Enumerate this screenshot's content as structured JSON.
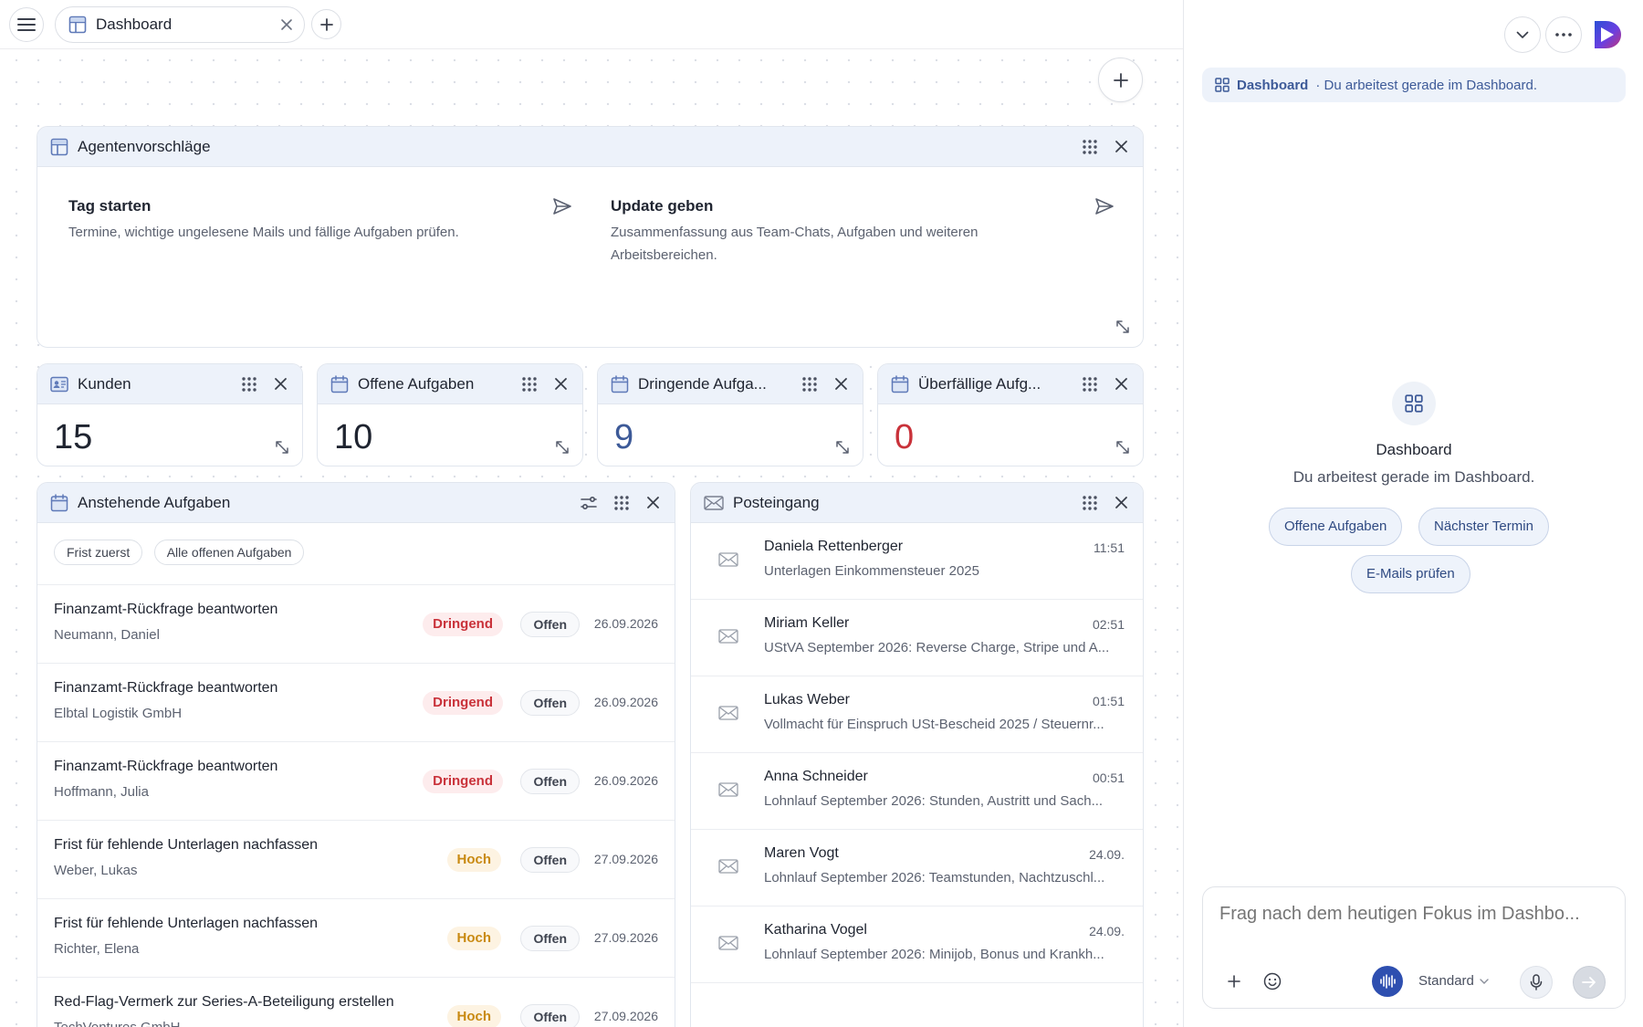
{
  "tab": {
    "label": "Dashboard"
  },
  "suggestions": {
    "title": "Agentenvorschläge",
    "items": [
      {
        "title": "Tag starten",
        "desc": "Termine, wichtige ungelesene Mails und fällige Aufgaben prüfen."
      },
      {
        "title": "Update geben",
        "desc": "Zusammenfassung aus Team-Chats, Aufgaben und weiteren Arbeitsbereichen."
      }
    ]
  },
  "stats": [
    {
      "title": "Kunden",
      "value": "15",
      "color": "#1f2430"
    },
    {
      "title": "Offene Aufgaben",
      "value": "10",
      "color": "#1f2430"
    },
    {
      "title": "Dringende Aufga...",
      "value": "9",
      "color": "#3d5a98"
    },
    {
      "title": "Überfällige Aufg...",
      "value": "0",
      "color": "#c9323a"
    }
  ],
  "tasks": {
    "title": "Anstehende Aufgaben",
    "filters": [
      "Frist zuerst",
      "Alle offenen Aufgaben"
    ],
    "rows": [
      {
        "title": "Finanzamt-Rückfrage beantworten",
        "client": "Neumann, Daniel",
        "priority": "Dringend",
        "status": "Offen",
        "date": "26.09.2026"
      },
      {
        "title": "Finanzamt-Rückfrage beantworten",
        "client": "Elbtal Logistik GmbH",
        "priority": "Dringend",
        "status": "Offen",
        "date": "26.09.2026"
      },
      {
        "title": "Finanzamt-Rückfrage beantworten",
        "client": "Hoffmann, Julia",
        "priority": "Dringend",
        "status": "Offen",
        "date": "26.09.2026"
      },
      {
        "title": "Frist für fehlende Unterlagen nachfassen",
        "client": "Weber, Lukas",
        "priority": "Hoch",
        "status": "Offen",
        "date": "27.09.2026"
      },
      {
        "title": "Frist für fehlende Unterlagen nachfassen",
        "client": "Richter, Elena",
        "priority": "Hoch",
        "status": "Offen",
        "date": "27.09.2026"
      },
      {
        "title": "Red-Flag-Vermerk zur Series-A-Beteiligung erstellen",
        "client": "TechVentures GmbH",
        "priority": "Hoch",
        "status": "Offen",
        "date": "27.09.2026"
      }
    ]
  },
  "inbox": {
    "title": "Posteingang",
    "mails": [
      {
        "from": "Daniela Rettenberger",
        "time": "11:51",
        "subject": "Unterlagen Einkommensteuer 2025"
      },
      {
        "from": "Miriam Keller",
        "time": "02:51",
        "subject": "UStVA September 2026: Reverse Charge, Stripe und A..."
      },
      {
        "from": "Lukas Weber",
        "time": "01:51",
        "subject": "Vollmacht für Einspruch USt-Bescheid 2025 / Steuernr..."
      },
      {
        "from": "Anna Schneider",
        "time": "00:51",
        "subject": "Lohnlauf September 2026: Stunden, Austritt und Sach..."
      },
      {
        "from": "Maren Vogt",
        "time": "24.09.",
        "subject": "Lohnlauf September 2026: Teamstunden, Nachtzuschl..."
      },
      {
        "from": "Katharina Vogel",
        "time": "24.09.",
        "subject": "Lohnlauf September 2026: Minijob, Bonus und Krankh..."
      }
    ]
  },
  "assistant": {
    "context_name": "Dashboard",
    "context_text": "· Du arbeitest gerade im Dashboard.",
    "title": "Dashboard",
    "subtitle": "Du arbeitest gerade im Dashboard.",
    "quick_actions": [
      "Offene Aufgaben",
      "Nächster Termin",
      "E-Mails prüfen"
    ],
    "input_placeholder": "Frag nach dem heutigen Fokus im Dashbo...",
    "mode_label": "Standard"
  },
  "colors": {
    "accent": "#3d5a98",
    "urgent": "#c9323a",
    "high": "#c98a12",
    "header_bg": "#edf2fa"
  }
}
